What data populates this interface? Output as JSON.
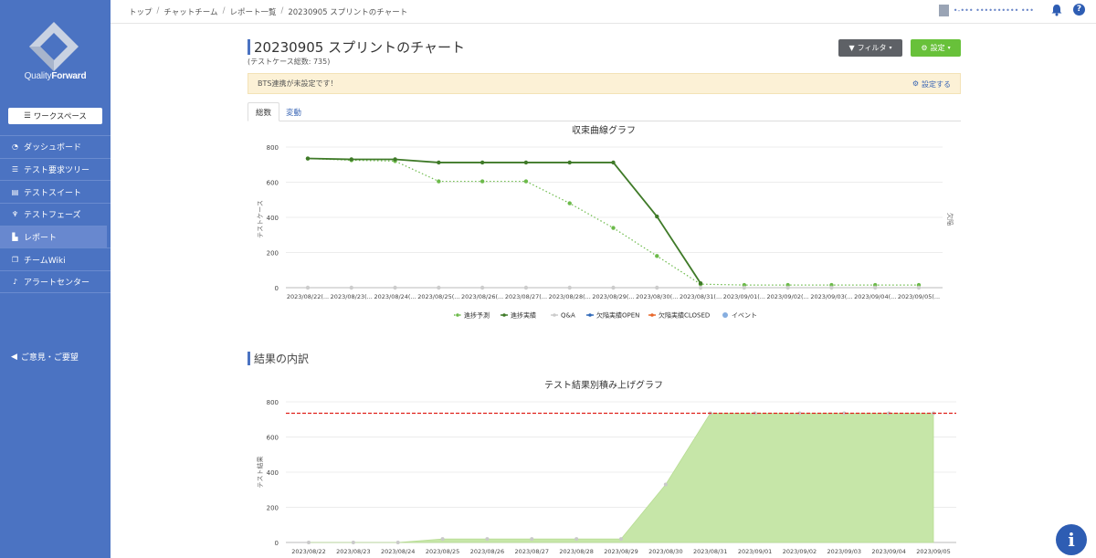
{
  "sidebar": {
    "brand_light": "Quality",
    "brand_bold": "Forward",
    "workspace_label": "ワークスペース",
    "items": [
      {
        "label": "ダッシュボード",
        "icon": "dashboard-icon"
      },
      {
        "label": "テスト要求ツリー",
        "icon": "list-icon"
      },
      {
        "label": "テストスイート",
        "icon": "document-icon"
      },
      {
        "label": "テストフェーズ",
        "icon": "stethoscope-icon"
      },
      {
        "label": "レポート",
        "icon": "chart-icon"
      },
      {
        "label": "チームWiki",
        "icon": "copy-icon"
      },
      {
        "label": "アラートセンター",
        "icon": "bell-icon"
      }
    ],
    "active_index": 4,
    "feedback_label": "ご意見・ご要望"
  },
  "breadcrumb": [
    "トップ",
    "チャットチーム",
    "レポート一覧",
    "20230905 スプリントのチャート"
  ],
  "user": {
    "name": "•-••• •••••••••• •••"
  },
  "page": {
    "title": "20230905 スプリントのチャート",
    "subtitle": "(テストケース総数: 735)",
    "filter_label": "フィルタ",
    "settings_label": "設定"
  },
  "alert": {
    "message": "BTS連携が未設定です！",
    "link": "設定する"
  },
  "tabs": [
    "総数",
    "変動"
  ],
  "section_title": "結果の内訳",
  "colors": {
    "accent": "#4b73c2",
    "green": "#4a8a2e",
    "forecast": "#6cba4a",
    "area": "#c6e6a8",
    "target": "#e0201b"
  },
  "chart_data": [
    {
      "type": "line",
      "title": "収束曲線グラフ",
      "ylabel": "テストケース",
      "y2label": "欠陥",
      "ylim": [
        0,
        800
      ],
      "yticks": [
        0,
        200,
        400,
        600,
        800
      ],
      "categories": [
        "2023/08/22(...",
        "2023/08/23(...",
        "2023/08/24(...",
        "2023/08/25(...",
        "2023/08/26(...",
        "2023/08/27(...",
        "2023/08/28(...",
        "2023/08/29(...",
        "2023/08/30(...",
        "2023/08/31(...",
        "2023/09/01(...",
        "2023/09/02(...",
        "2023/09/03(...",
        "2023/09/04(...",
        "2023/09/05(..."
      ],
      "series": [
        {
          "name": "進捗予測",
          "style": "dotted",
          "color": "#6cba4a",
          "values": [
            735,
            725,
            720,
            605,
            605,
            605,
            480,
            340,
            180,
            20,
            15,
            15,
            15,
            15,
            15
          ]
        },
        {
          "name": "進捗実績",
          "style": "solid",
          "color": "#3f7a28",
          "values": [
            735,
            730,
            730,
            712,
            712,
            712,
            712,
            712,
            405,
            25,
            null,
            null,
            null,
            null,
            null
          ]
        },
        {
          "name": "Q&A",
          "style": "solid",
          "color": "#cccccc",
          "values": [
            0,
            0,
            0,
            0,
            0,
            0,
            0,
            0,
            0,
            0,
            0,
            0,
            0,
            0,
            0
          ]
        },
        {
          "name": "欠陥実績OPEN",
          "style": "solid",
          "color": "#2f68b8",
          "values": []
        },
        {
          "name": "欠陥実績CLOSED",
          "style": "solid",
          "color": "#e8672b",
          "values": []
        },
        {
          "name": "イベント",
          "style": "marker",
          "color": "#86aee0",
          "values": []
        }
      ]
    },
    {
      "type": "area",
      "title": "テスト結果別積み上げグラフ",
      "ylabel": "テスト結果",
      "ylim": [
        0,
        800
      ],
      "yticks": [
        0,
        200,
        400,
        600,
        800
      ],
      "categories": [
        "2023/08/22",
        "2023/08/23",
        "2023/08/24",
        "2023/08/25",
        "2023/08/26",
        "2023/08/27",
        "2023/08/28",
        "2023/08/29",
        "2023/08/30",
        "2023/08/31",
        "2023/09/01",
        "2023/09/02",
        "2023/09/03",
        "2023/09/04",
        "2023/09/05"
      ],
      "target": 735,
      "values": [
        0,
        0,
        0,
        20,
        20,
        20,
        20,
        20,
        330,
        735,
        735,
        735,
        735,
        735,
        735
      ]
    }
  ]
}
